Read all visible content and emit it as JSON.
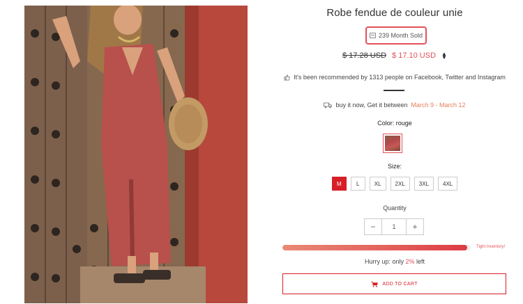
{
  "product": {
    "title": "Robe fendue de couleur unie",
    "sold_text": "239 Month Sold",
    "old_price": "$ 17.28 USD",
    "new_price": "$ 17.10 USD",
    "currency_icon": "sort-arrows-icon",
    "image_alt": "Woman wearing a long red sleeveless dress with a side slit, holding a woven bag, standing by a wooden door"
  },
  "social": {
    "recommend_text": "It's been recommended by 1313 people on Facebook, Twitter and Instagram",
    "icon": "thumbs-up-icon"
  },
  "delivery": {
    "prefix": "buy it now, Get it between",
    "dates": "March 9 - March 12",
    "icon": "truck-icon"
  },
  "color": {
    "label": "Color: rouge",
    "selected": "rouge"
  },
  "size": {
    "label": "Size:",
    "options": [
      "M",
      "L",
      "XL",
      "2XL",
      "3XL",
      "4XL"
    ],
    "selected": "M"
  },
  "quantity": {
    "label": "Quantity",
    "value": "1",
    "minus": "−",
    "plus": "+"
  },
  "inventory": {
    "progress_fraction": 0.98,
    "tight_label": "Tight Inventory!",
    "hurry_prefix": "Hurry up: only",
    "hurry_percent": "2%",
    "hurry_suffix": "left"
  },
  "cart": {
    "label": "ADD TO CART",
    "icon": "cart-icon"
  },
  "colors": {
    "accent": "#e2505a",
    "selected_size": "#d81e27",
    "highlight_orange": "#e2805a"
  }
}
